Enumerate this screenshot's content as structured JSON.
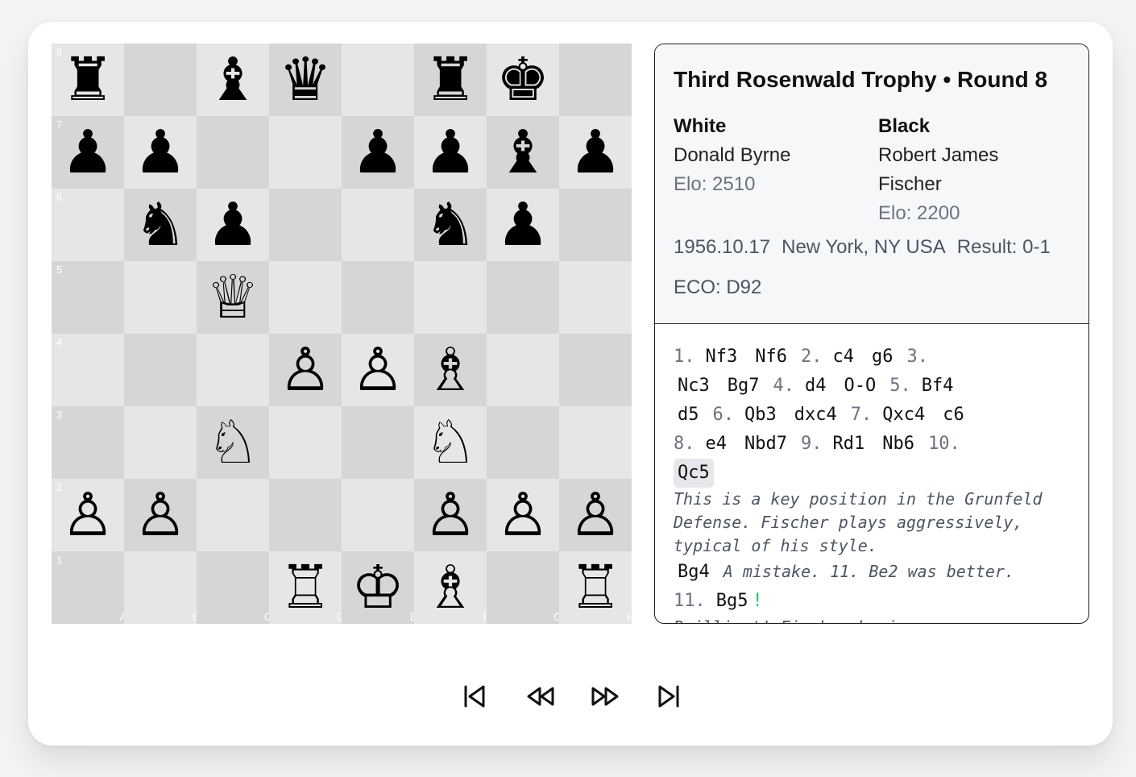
{
  "game": {
    "title": "Third Rosenwald Trophy • Round 8",
    "white": {
      "heading": "White",
      "name": "Donald Byrne",
      "elo": "Elo: 2510"
    },
    "black": {
      "heading": "Black",
      "name_line1": "Robert James",
      "name_line2": "Fischer",
      "elo": "Elo: 2200"
    },
    "date": "1956.10.17",
    "site": "New York, NY USA",
    "result": "Result: 0-1",
    "eco": "ECO: D92"
  },
  "board": {
    "files": [
      "A",
      "B",
      "C",
      "D",
      "E",
      "F",
      "G",
      "H"
    ],
    "ranks": [
      "8",
      "7",
      "6",
      "5",
      "4",
      "3",
      "2",
      "1"
    ],
    "position": [
      [
        "♜",
        "",
        "♝",
        "♛",
        "",
        "♜",
        "♚",
        ""
      ],
      [
        "♟",
        "♟",
        "",
        "",
        "♟",
        "♟",
        "♝",
        "♟"
      ],
      [
        "",
        "♞",
        "♟",
        "",
        "",
        "♞",
        "♟",
        ""
      ],
      [
        "",
        "",
        "♕",
        "",
        "",
        "",
        "",
        ""
      ],
      [
        "",
        "",
        "",
        "♙",
        "♙",
        "♗",
        "",
        ""
      ],
      [
        "",
        "",
        "♘",
        "",
        "",
        "♘",
        "",
        ""
      ],
      [
        "♙",
        "♙",
        "",
        "",
        "",
        "♙",
        "♙",
        "♙"
      ],
      [
        "",
        "",
        "",
        "♖",
        "♔",
        "♗",
        "",
        "♖"
      ]
    ]
  },
  "moves": {
    "line1": {
      "n1": "1.",
      "m1": "Nf3",
      "m2": "Nf6",
      "n2": "2.",
      "m3": "c4",
      "m4": "g6",
      "n3": "3."
    },
    "line2": {
      "m1": "Nc3",
      "m2": "Bg7",
      "n1": "4.",
      "m3": "d4",
      "m4": "O-O",
      "n2": "5.",
      "m5": "Bf4"
    },
    "line3": {
      "m1": "d5",
      "n1": "6.",
      "m2": "Qb3",
      "m3": "dxc4",
      "n2": "7.",
      "m4": "Qxc4",
      "m5": "c6"
    },
    "line4": {
      "n1": "8.",
      "m1": "e4",
      "m2": "Nbd7",
      "n2": "9.",
      "m3": "Rd1",
      "m4": "Nb6",
      "n3": "10."
    },
    "line5": {
      "m1": "Qc5"
    },
    "comment1": "This is a key position in the Grunfeld Defense. Fischer plays aggressively, typical of his style.",
    "line6": {
      "m1": "Bg4",
      "comment": "A mistake. 11. Be2 was better."
    },
    "line7": {
      "n1": "11.",
      "m1": "Bg5",
      "annotation": "!"
    },
    "comment2": "Brilliant! Fischer begins a"
  },
  "controls": {
    "first": "skip-to-start-icon",
    "prev": "rewind-icon",
    "next": "fast-forward-icon",
    "last": "skip-to-end-icon"
  }
}
